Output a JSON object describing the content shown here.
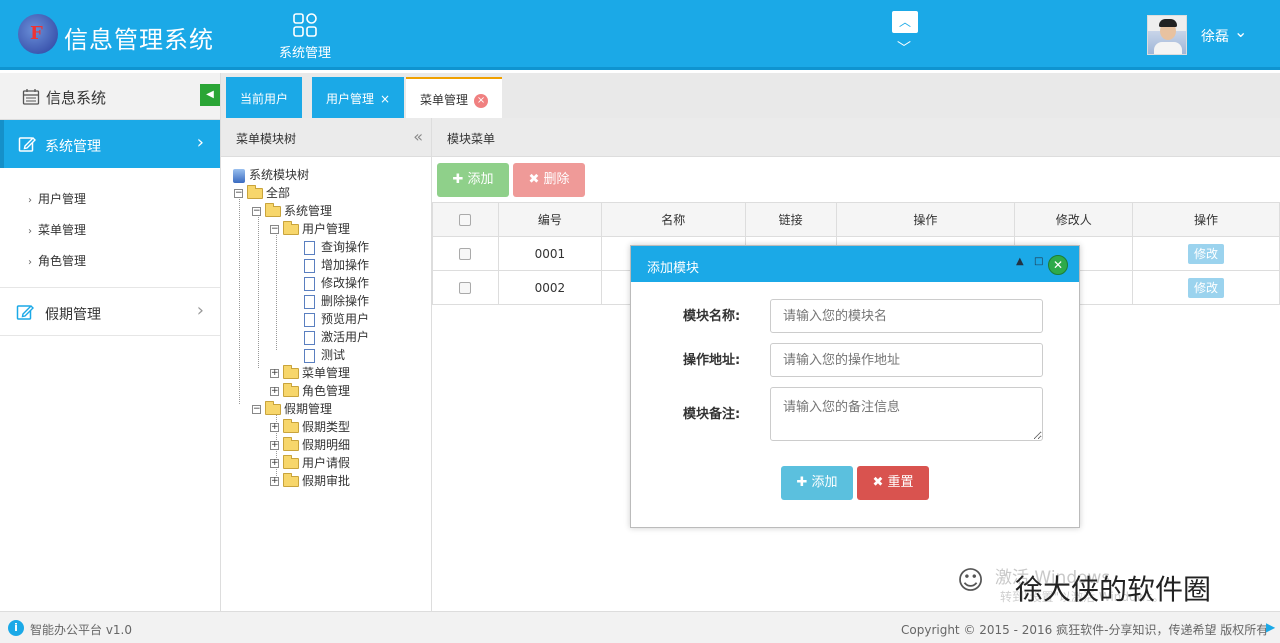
{
  "header": {
    "app_title": "信息管理系统",
    "logo_letter": "F",
    "nav_label": "系统管理",
    "username": "徐磊"
  },
  "sidebar": {
    "section_title": "信息系统",
    "active_menu": "系统管理",
    "submenu": [
      "用户管理",
      "菜单管理",
      "角色管理"
    ],
    "other_menu": "假期管理"
  },
  "tabs": [
    {
      "label": "当前用户"
    },
    {
      "label": "用户管理"
    },
    {
      "label": "菜单管理"
    }
  ],
  "tree_panel": {
    "title": "菜单模块树",
    "nodes": {
      "root": "系统模块树",
      "all": "全部",
      "sys": "系统管理",
      "user": "用户管理",
      "op1": "查询操作",
      "op2": "增加操作",
      "op3": "修改操作",
      "op4": "删除操作",
      "op5": "预览用户",
      "op6": "激活用户",
      "op7": "测试",
      "menu": "菜单管理",
      "role": "角色管理",
      "holiday": "假期管理",
      "h1": "假期类型",
      "h2": "假期明细",
      "h3": "用户请假",
      "h4": "假期审批"
    }
  },
  "content": {
    "title": "模块菜单",
    "add_label": "添加",
    "delete_label": "删除",
    "columns": [
      "编号",
      "名称",
      "链接",
      "操作",
      "修改人",
      "操作"
    ],
    "rows": [
      {
        "id": "0001",
        "edit": "修改"
      },
      {
        "id": "0002",
        "edit": "修改"
      }
    ]
  },
  "modal": {
    "title": "添加模块",
    "fields": [
      {
        "label": "模块名称:",
        "placeholder": "请输入您的模块名"
      },
      {
        "label": "操作地址:",
        "placeholder": "请输入您的操作地址"
      },
      {
        "label": "模块备注:",
        "placeholder": "请输入您的备注信息"
      }
    ],
    "add_label": "添加",
    "reset_label": "重置"
  },
  "watermark": {
    "activate": "激活 Windows",
    "activate_sub": "转到\"设置\"以激活 Windows。",
    "brand": "徐大侠的软件圈"
  },
  "footer": {
    "version": "智能办公平台 v1.0",
    "copyright": "Copyright © 2015 - 2016 疯狂软件-分享知识，传递希望 版权所有"
  },
  "colors": {
    "primary": "#1ba9e7",
    "success": "#2aa536",
    "danger": "#d9534f",
    "info": "#5bc0de"
  }
}
